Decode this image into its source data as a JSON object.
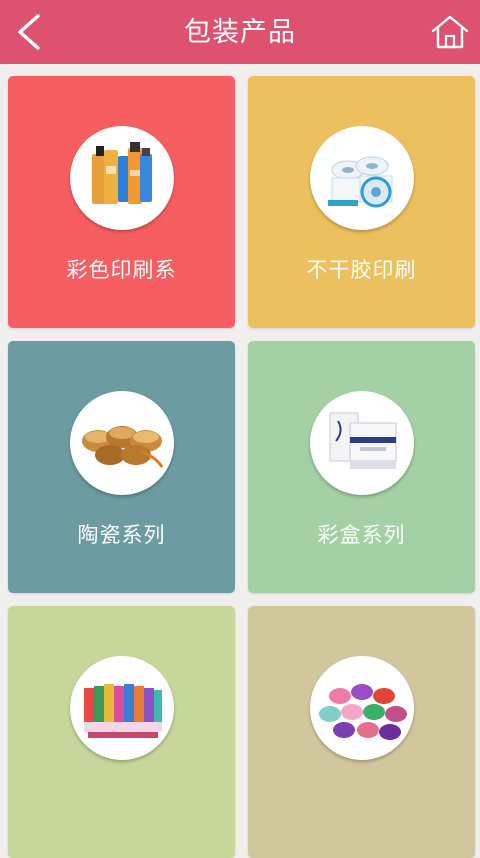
{
  "header": {
    "title": "包装产品",
    "back_icon": "chevron-left-icon",
    "home_icon": "home-icon",
    "background": "#dd5270"
  },
  "categories": [
    {
      "label": "彩色印刷系",
      "color": "#f65e62",
      "thumbnail": "color-printing-packages"
    },
    {
      "label": "不干胶印刷",
      "color": "#ecc05e",
      "thumbnail": "label-rolls"
    },
    {
      "label": "陶瓷系列",
      "color": "#6c9ba2",
      "thumbnail": "ceramic-jars"
    },
    {
      "label": "彩盒系列",
      "color": "#a3d0a4",
      "thumbnail": "gift-boxes"
    },
    {
      "label": "",
      "color": "#c7d69a",
      "thumbnail": "ribbon-spools"
    },
    {
      "label": "",
      "color": "#d0c79d",
      "thumbnail": "round-tins"
    }
  ]
}
